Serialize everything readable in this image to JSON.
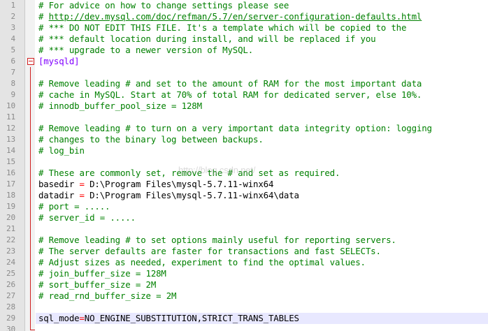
{
  "editor": {
    "current_line": 29,
    "colors": {
      "comment": "#008000",
      "section": "#8000ff",
      "operator": "#ff0000",
      "text": "#000000",
      "gutter": "#e4e4e4",
      "fold_marker": "#d02020",
      "current_line_bg": "#e8e8ff"
    },
    "lines": [
      {
        "n": "1",
        "kind": "comment",
        "text": "# For advice on how to change settings please see"
      },
      {
        "n": "2",
        "kind": "comment-link",
        "prefix": "# ",
        "link": "http://dev.mysql.com/doc/refman/5.7/en/server-configuration-defaults.html"
      },
      {
        "n": "3",
        "kind": "comment",
        "text": "# *** DO NOT EDIT THIS FILE. It's a template which will be copied to the"
      },
      {
        "n": "4",
        "kind": "comment",
        "text": "# *** default location during install, and will be replaced if you"
      },
      {
        "n": "5",
        "kind": "comment",
        "text": "# *** upgrade to a newer version of MySQL."
      },
      {
        "n": "6",
        "kind": "section",
        "text": "[mysqld]",
        "fold": "start"
      },
      {
        "n": "7",
        "kind": "blank",
        "text": "",
        "fold": "mid"
      },
      {
        "n": "8",
        "kind": "comment",
        "text": "# Remove leading # and set to the amount of RAM for the most important data",
        "fold": "mid"
      },
      {
        "n": "9",
        "kind": "comment",
        "text": "# cache in MySQL. Start at 70% of total RAM for dedicated server, else 10%.",
        "fold": "mid"
      },
      {
        "n": "10",
        "kind": "comment",
        "text": "# innodb_buffer_pool_size = 128M",
        "fold": "mid"
      },
      {
        "n": "11",
        "kind": "blank",
        "text": "",
        "fold": "mid"
      },
      {
        "n": "12",
        "kind": "comment",
        "text": "# Remove leading # to turn on a very important data integrity option: logging",
        "fold": "mid"
      },
      {
        "n": "13",
        "kind": "comment",
        "text": "# changes to the binary log between backups.",
        "fold": "mid"
      },
      {
        "n": "14",
        "kind": "comment",
        "text": "# log_bin",
        "fold": "mid"
      },
      {
        "n": "15",
        "kind": "blank",
        "text": "",
        "fold": "mid"
      },
      {
        "n": "16",
        "kind": "comment",
        "text": "# These are commonly set, remove the # and set as required.",
        "fold": "mid"
      },
      {
        "n": "17",
        "kind": "kv",
        "key": "basedir",
        "op": " = ",
        "value": "D:\\Program Files\\mysql-5.7.11-winx64",
        "fold": "mid"
      },
      {
        "n": "18",
        "kind": "kv",
        "key": "datadir",
        "op": " = ",
        "value": "D:\\Program Files\\mysql-5.7.11-winx64\\data",
        "fold": "mid"
      },
      {
        "n": "19",
        "kind": "comment",
        "text": "# port = .....",
        "fold": "mid"
      },
      {
        "n": "20",
        "kind": "comment",
        "text": "# server_id = .....",
        "fold": "mid"
      },
      {
        "n": "21",
        "kind": "blank",
        "text": "",
        "fold": "mid"
      },
      {
        "n": "22",
        "kind": "comment",
        "text": "# Remove leading # to set options mainly useful for reporting servers.",
        "fold": "mid"
      },
      {
        "n": "23",
        "kind": "comment",
        "text": "# The server defaults are faster for transactions and fast SELECTs.",
        "fold": "mid"
      },
      {
        "n": "24",
        "kind": "comment",
        "text": "# Adjust sizes as needed, experiment to find the optimal values.",
        "fold": "mid"
      },
      {
        "n": "25",
        "kind": "comment",
        "text": "# join_buffer_size = 128M",
        "fold": "mid"
      },
      {
        "n": "26",
        "kind": "comment",
        "text": "# sort_buffer_size = 2M",
        "fold": "mid"
      },
      {
        "n": "27",
        "kind": "comment",
        "text": "# read_rnd_buffer_size = 2M",
        "fold": "mid"
      },
      {
        "n": "28",
        "kind": "blank",
        "text": "",
        "fold": "mid"
      },
      {
        "n": "29",
        "kind": "kv",
        "key": "sql_mode",
        "op": "=",
        "value": "NO_ENGINE_SUBSTITUTION,STRICT_TRANS_TABLES",
        "fold": "mid"
      },
      {
        "n": "30",
        "kind": "blank",
        "text": "",
        "fold": "end"
      }
    ]
  }
}
